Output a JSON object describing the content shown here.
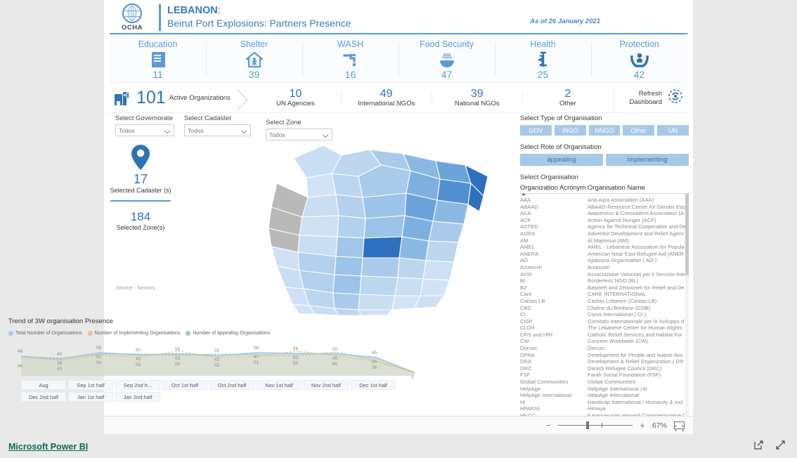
{
  "header": {
    "logo_alt": "OCHA",
    "country": "LEBANON",
    "colon": ":",
    "subtitle": "Beirut Port Explosions: Partners Presence",
    "as_of": "As of 26 January 2021",
    "accent": "#5b9bd5"
  },
  "sectors": [
    {
      "name": "Education",
      "value": "11",
      "icon": "book-icon"
    },
    {
      "name": "Shelter",
      "value": "39",
      "icon": "shelter-icon"
    },
    {
      "name": "WASH",
      "value": "16",
      "icon": "faucet-icon"
    },
    {
      "name": "Food Security",
      "value": "47",
      "icon": "food-bowl-icon"
    },
    {
      "name": "Health",
      "value": "25",
      "icon": "stethoscope-icon"
    },
    {
      "name": "Protection",
      "value": "42",
      "icon": "protection-hands-icon"
    }
  ],
  "orgs": {
    "total": "101",
    "total_label": "Active Organizations",
    "types": [
      {
        "value": "10",
        "label": "UN Agencies"
      },
      {
        "value": "49",
        "label": "International NGOs"
      },
      {
        "value": "39",
        "label": "National NGOs"
      },
      {
        "value": "2",
        "label": "Other"
      }
    ],
    "refresh_line1": "Refresh",
    "refresh_line2": "Dashboard"
  },
  "filters": [
    {
      "label": "Select  Governorate",
      "value": "Todos"
    },
    {
      "label": "Select Cadaster",
      "value": "Todos"
    },
    {
      "label": "Select Zone",
      "value": "Todos"
    }
  ],
  "kpi": {
    "cadaster_value": "17",
    "cadaster_label": "Selected Cadaster (s)",
    "zone_value": "184",
    "zone_label": "Selected Zone(s)",
    "source": "Source : Sectors"
  },
  "right_panel": {
    "type_label": "Select Type of Organisation",
    "type_options": [
      "GOV",
      "INGO",
      "NNGO",
      "Other",
      "UN"
    ],
    "role_label": "Select Role of Organisation",
    "role_options": [
      "appealing",
      "implementing"
    ],
    "org_label": "Select Organisation",
    "col_acronym": "Organization Acronym",
    "col_name": "Organisation Name",
    "rows": [
      [
        "AAA",
        "Ana Aqra Association (AAA)"
      ],
      [
        "ABAAD",
        "ABAAD-Resource Center for Gender Equ"
      ],
      [
        "ACA",
        "Awareness & Consolation Association (A"
      ],
      [
        "ACF",
        "Action Against Hunger (ACF)"
      ],
      [
        "ACTED",
        "Agency for Technical Cooperation and De"
      ],
      [
        "ADRA",
        "Adventist Development and Relief Agenc"
      ],
      [
        "AM",
        "Al Majmoua (AM)"
      ],
      [
        "AMEL",
        "AMEL - Lebanese Association for Popula"
      ],
      [
        "ANERA",
        "American Near East Refugee Aid (ANER"
      ],
      [
        "AO",
        "Ajialouna Organization ( AO )"
      ],
      [
        "Arcenciel",
        "Arcenciel"
      ],
      [
        "AVSI",
        "Associazione Volontari per il Servizio Inte"
      ],
      [
        "BL",
        "Borderless NGO (BL)"
      ],
      [
        "BZ",
        "Basmeh and Zeitooneh for Relief and De"
      ],
      [
        "Care",
        "CARE INTERNATIONAL"
      ],
      [
        "Caritas LB",
        "Caritas Lebanon (Caritas LB)"
      ],
      [
        "CBD",
        "Chaîne du Bonheur (CDB)"
      ],
      [
        "CI",
        "Corus International ( CI )"
      ],
      [
        "CISP",
        "Comitato Internationale per lo Sviluppo d"
      ],
      [
        "CLDH",
        "The Lebanese Center for Human Rights"
      ],
      [
        "CRS and HfH",
        "Catholic Relief Services and Habitat For"
      ],
      [
        "CW",
        "Concern Worldwide (CW)"
      ],
      [
        "Dorcas",
        "Dorcas"
      ],
      [
        "DPNA",
        "Development for People and Nature Ass"
      ],
      [
        "DRA",
        "Development & Relief Organization ( DR"
      ],
      [
        "DRC",
        "Danish Refugee Council (DRC)"
      ],
      [
        "FSF",
        "Farah Social Foundation (FSF)"
      ],
      [
        "Global Communities",
        "Global Communities"
      ],
      [
        "HelpAge",
        "HelpAge International UK"
      ],
      [
        "HelpAge International",
        "HelpAge International"
      ],
      [
        "HI",
        "Handicap International / Humanity & Incl"
      ],
      [
        "HIMAYA",
        "Himaya"
      ],
      [
        "HKCC",
        "Karagueuzian Howard Commemorative C"
      ]
    ]
  },
  "chart_data": {
    "type": "line",
    "title": "Trend of 3W organisation Presence",
    "legend": [
      {
        "name": "Total Number of Organisations",
        "color": "#aec7e8"
      },
      {
        "name": "Number of Implementing Organisations",
        "color": "#f7b99a"
      },
      {
        "name": "Number of appealing Organisations",
        "color": "#9dd3a8"
      }
    ],
    "legend_position": "top",
    "grid": false,
    "xlabel": "",
    "ylabel": "",
    "ylim": [
      0,
      65
    ],
    "categories": [
      "Aug",
      "Sep 1st half",
      "Sep 2nd h...",
      "Oct 1st half",
      "Oct 2nd half",
      "Nov 1st half",
      "Nov 2nd half",
      "Dec 1st half",
      "Dec 2nd half",
      "Jan 1st half",
      "Jan 2nd half"
    ],
    "series": [
      {
        "name": "Total Number of Organisations",
        "color": "#aec7e8",
        "values": [
          48,
          40,
          58,
          52,
          55,
          50,
          58,
          56,
          55,
          45,
          1
        ]
      },
      {
        "name": "Number of Implementing Organisations",
        "color": "#f7b99a",
        "values": [
          46,
          36,
          51,
          45,
          63,
          43,
          47,
          63,
          49,
          34,
          1
        ]
      },
      {
        "name": "Number of appealing Organisations",
        "color": "#9dd3a8",
        "values": [
          46,
          43,
          54,
          55,
          50,
          55,
          51,
          50,
          60,
          36,
          1
        ]
      }
    ],
    "point_labels_top": [
      "48",
      "40",
      "58",
      "52",
      "55",
      "50",
      "58",
      "56",
      "55",
      "45",
      ""
    ],
    "point_labels_mid": [
      "",
      "36",
      "51",
      "45",
      "63",
      "43",
      "47",
      "63",
      "49",
      "34",
      "1"
    ],
    "point_labels_bottom": [
      "46",
      "43",
      "54",
      "55",
      "50",
      "55",
      "51",
      "50",
      "60",
      "36",
      ""
    ]
  },
  "zoombar": {
    "minus": "−",
    "plus": "+",
    "percent": "67%",
    "fit_icon": "fit-to-page-icon"
  },
  "bottom": {
    "brand": "Microsoft Power BI",
    "icons": [
      "share-icon",
      "fullscreen-icon"
    ]
  }
}
